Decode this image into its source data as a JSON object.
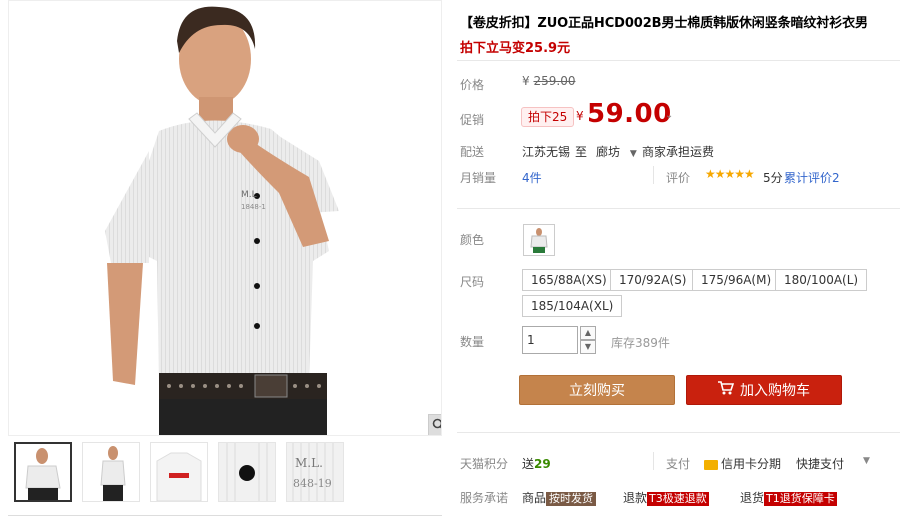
{
  "product": {
    "title": "【卷皮折扣】ZUO正品HCD002B男士棉质韩版休闲竖条暗纹衬衫衣男",
    "subtitle": "拍下立马变25.9元"
  },
  "price": {
    "label": "价格",
    "currency": "¥",
    "original": "259.00",
    "promo_label": "促销",
    "promo_tag": "拍下25",
    "promo_price": "59.00"
  },
  "shipping": {
    "label": "配送",
    "from": "江苏无锡",
    "to_word": "至",
    "destination": "廊坊",
    "fee_text": "商家承担运费"
  },
  "sales": {
    "label": "月销量",
    "count": "4件",
    "rating_label": "评价",
    "stars": "★★★★★",
    "score": "5分",
    "review_link": "累计评价2"
  },
  "options": {
    "color_label": "颜色",
    "size_label": "尺码",
    "sizes": [
      "165/88A(XS)",
      "170/92A(S)",
      "175/96A(M)",
      "180/100A(L)",
      "185/104A(XL)"
    ]
  },
  "quantity": {
    "label": "数量",
    "value": "1",
    "stock": "库存389件"
  },
  "actions": {
    "buy_now": "立刻购买",
    "add_cart": "加入购物车"
  },
  "footer": {
    "points_label": "天猫积分",
    "points_prefix": "送",
    "points_value": "29",
    "pay_label": "支付",
    "pay_card": "信用卡分期",
    "pay_fast": "快捷支付",
    "service_label": "服务承诺",
    "service_1_prefix": "商品",
    "service_1_tag": "按时发货",
    "service_2_prefix": "退款",
    "service_2_tag": "T3极速退款",
    "service_3_prefix": "退货",
    "service_3_tag": "T1退货保障卡"
  },
  "icons": {
    "zoom": "magnifier-icon",
    "cart": "cart-icon",
    "dropdown": "chevron-down-icon"
  },
  "colors": {
    "accent_red": "#c40000",
    "buy_button": "#c5844c",
    "cart_button": "#c9210e"
  }
}
